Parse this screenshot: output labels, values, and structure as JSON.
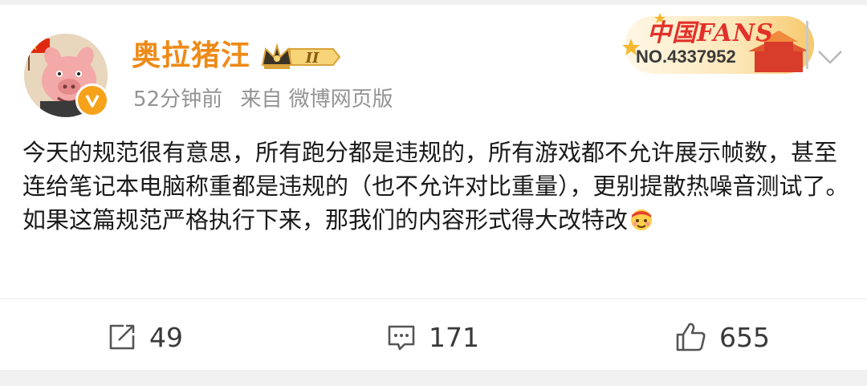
{
  "post": {
    "user": {
      "name": "奥拉猪汪",
      "vip_level": "II",
      "time": "52分钟前",
      "source": "来自 微博网页版"
    },
    "fan_card": {
      "title": "中国FANS",
      "number": "NO.4337952"
    },
    "content": {
      "line1": "今天的规范很有意思，所有跑分都是违规的，所有游戏都不允许展示帧数，甚至连给笔记本电脑称重都是违规的（也不允许对比重量），更别提散热噪音测试了。",
      "line2": "如果这篇规范严格执行下来，那我们的内容形式得大改特改"
    },
    "actions": {
      "repost_count": "49",
      "comment_count": "171",
      "like_count": "655"
    }
  },
  "colors": {
    "username": "#ee8a17",
    "meta": "#939393",
    "text": "#1a1a1a",
    "verified": "#f7a21b"
  },
  "icons": [
    "avatar-pig",
    "verified-icon",
    "vip-crown-badge",
    "fan-card",
    "chevron-down-icon",
    "repost-icon",
    "comment-icon",
    "like-icon",
    "emoji-icon"
  ]
}
